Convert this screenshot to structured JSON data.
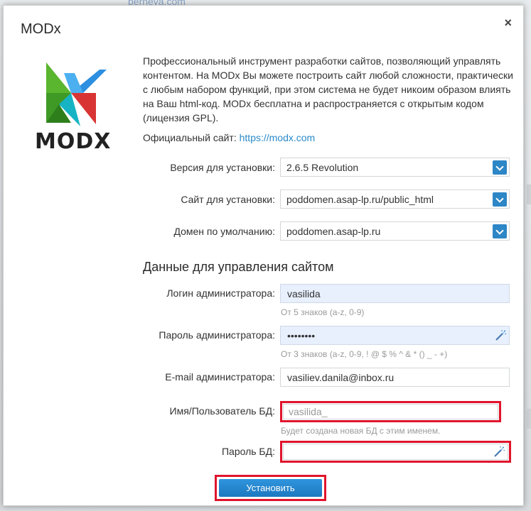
{
  "background": {
    "link_text": "berneya.com"
  },
  "dialog": {
    "title": "MODx",
    "close_glyph": "×",
    "logo_text": "MODX",
    "description": "Профессиональный инструмент разработки сайтов, позволяющий управлять контентом. На MODx Вы можете построить сайт любой сложности, практически с любым набором функций, при этом система не будет никоим образом влиять на Ваш html-код. MODx бесплатна и распространяется с открытым кодом (лицензия GPL).",
    "official_site_label": "Официальный сайт:",
    "official_site_link": "https://modx.com"
  },
  "install_options": {
    "version": {
      "label": "Версия для установки:",
      "value": "2.6.5 Revolution"
    },
    "site": {
      "label": "Сайт для установки:",
      "value": "poddomen.asap-lp.ru/public_html"
    },
    "domain": {
      "label": "Домен по умолчанию:",
      "value": "poddomen.asap-lp.ru"
    }
  },
  "admin_section": {
    "heading": "Данные для управления сайтом",
    "login": {
      "label": "Логин администратора:",
      "value": "vasilida",
      "hint": "От 5 знаков (a-z, 0-9)"
    },
    "password": {
      "label": "Пароль администратора:",
      "value": "••••••••",
      "hint": "От 3 знаков (a-z, 0-9, ! @ $ % ^ & * () _ - +)"
    },
    "email": {
      "label": "E-mail администратора:",
      "value": "vasiliev.danila@inbox.ru"
    },
    "db_user": {
      "label": "Имя/Пользователь БД:",
      "placeholder": "vasilida_",
      "hint": "Будет создана новая БД с этим именем."
    },
    "db_password": {
      "label": "Пароль БД:",
      "value": ""
    }
  },
  "install_button": {
    "label": "Установить"
  },
  "colors": {
    "accent": "#2d86c6",
    "highlight": "#e0142c",
    "logo_green": "#5ab52f",
    "logo_blue": "#2d8fe0",
    "logo_red": "#d93434"
  },
  "icons": [
    "close-icon",
    "modx-logo-icon",
    "chevron-down-icon",
    "magic-wand-icon"
  ]
}
